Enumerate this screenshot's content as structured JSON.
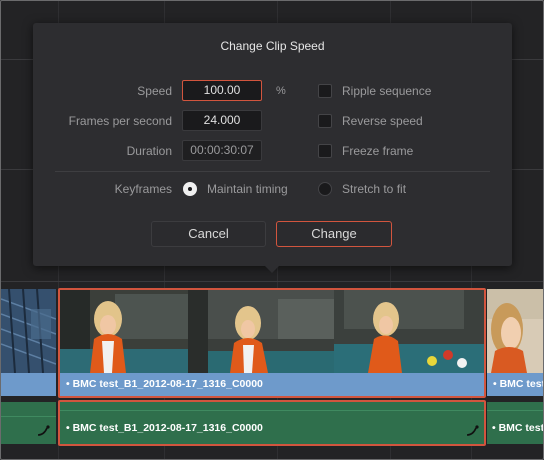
{
  "dialog": {
    "title": "Change Clip Speed",
    "speed_label": "Speed",
    "speed_value": "100.00",
    "speed_unit": "%",
    "fps_label": "Frames per second",
    "fps_value": "24.000",
    "duration_label": "Duration",
    "duration_value": "00:00:30:07",
    "ripple_label": "Ripple sequence",
    "reverse_label": "Reverse speed",
    "freeze_label": "Freeze frame",
    "ripple_checked": false,
    "reverse_checked": false,
    "freeze_checked": false,
    "keyframes_label": "Keyframes",
    "maintain_label": "Maintain timing",
    "stretch_label": "Stretch to fit",
    "keyframes_selected": "Maintain timing",
    "cancel_label": "Cancel",
    "change_label": "Change"
  },
  "timeline": {
    "video_clips": [
      {
        "label": ""
      },
      {
        "label": "• BMC test_B1_2012-08-17_1316_C0000"
      },
      {
        "label": "• BMC test"
      }
    ],
    "audio_clips": [
      {
        "label": ""
      },
      {
        "label": "• BMC test_B1_2012-08-17_1316_C0000"
      },
      {
        "label": "• BMC test"
      }
    ]
  },
  "colors": {
    "accent": "#d2553e",
    "video_clip": "#6e9acb",
    "audio_clip": "#2f6f4c",
    "dialog_bg": "#2d2d30"
  }
}
